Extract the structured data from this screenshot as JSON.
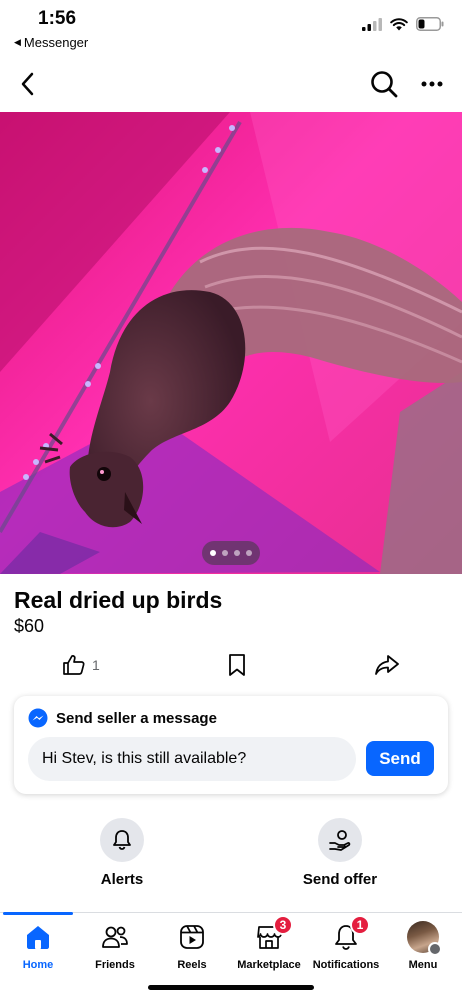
{
  "status_bar": {
    "time": "1:56",
    "back_app": "Messenger",
    "battery_percent": 30
  },
  "nav": {
    "back_icon": "chevron-left-icon",
    "search_icon": "search-icon",
    "more_icon": "more-dots-icon"
  },
  "photo": {
    "description_colors": {
      "primary": "#e0157a",
      "accent": "#ff2fb0",
      "led": "#8c6bff"
    },
    "page_count": 4,
    "current_page": 1
  },
  "listing": {
    "title": "Real dried up birds",
    "price": "$60",
    "like_count": "1"
  },
  "message_card": {
    "heading": "Send seller a message",
    "input_value": "Hi Stev, is this still available?",
    "send_label": "Send"
  },
  "quick_actions": {
    "alerts_label": "Alerts",
    "offer_label": "Send offer"
  },
  "tabs": [
    {
      "label": "Home",
      "icon": "home-icon",
      "active": true
    },
    {
      "label": "Friends",
      "icon": "friends-icon"
    },
    {
      "label": "Reels",
      "icon": "reels-icon"
    },
    {
      "label": "Marketplace",
      "icon": "marketplace-icon",
      "badge": "3"
    },
    {
      "label": "Notifications",
      "icon": "bell-icon",
      "badge": "1"
    },
    {
      "label": "Menu",
      "icon": "avatar-icon"
    }
  ],
  "colors": {
    "brand_blue": "#0866ff",
    "badge_red": "#e41e3f",
    "muted": "#65676b"
  }
}
